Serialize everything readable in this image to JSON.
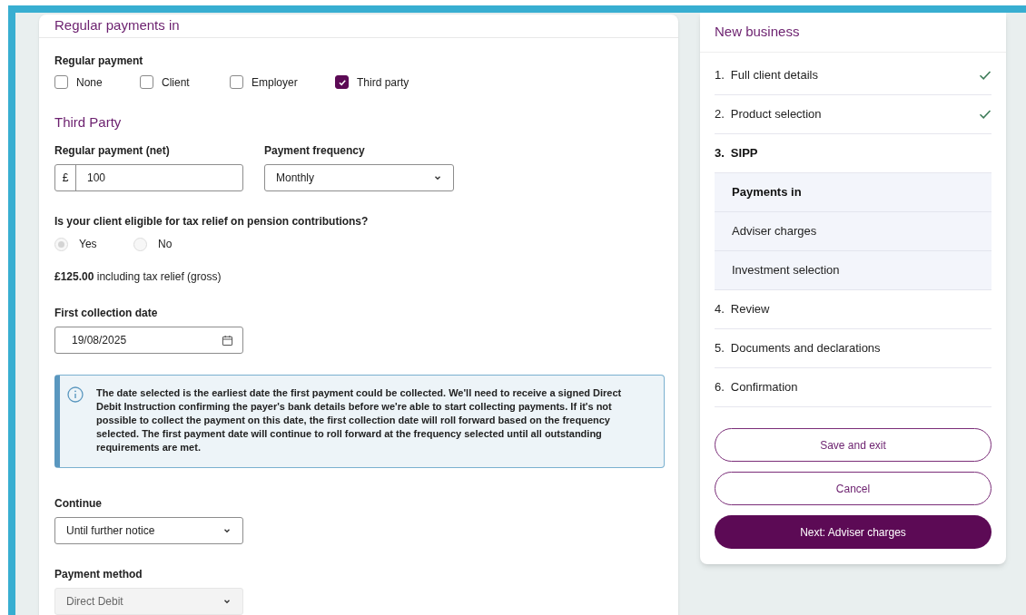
{
  "form": {
    "title": "Regular payments in",
    "regular_payment": {
      "label": "Regular payment",
      "options": [
        {
          "label": "None",
          "checked": false
        },
        {
          "label": "Client",
          "checked": false
        },
        {
          "label": "Employer",
          "checked": false
        },
        {
          "label": "Third party",
          "checked": true
        }
      ]
    },
    "section_title": "Third Party",
    "amount": {
      "label": "Regular payment (net)",
      "prefix": "£",
      "value": "100"
    },
    "frequency": {
      "label": "Payment frequency",
      "value": "Monthly"
    },
    "tax_relief": {
      "question": "Is your client eligible for tax relief on pension contributions?",
      "disabled": true,
      "options": [
        {
          "label": "Yes",
          "selected": true
        },
        {
          "label": "No",
          "selected": false
        }
      ]
    },
    "gross": "**£125.00** including tax relief (gross)",
    "collection_date": {
      "label": "First collection date",
      "value": "19/08/2025"
    },
    "info": "The date selected is the earliest date the first payment could be collected. We'll need to receive a signed Direct Debit Instruction confirming the payer's bank details before we're able to start collecting payments. If it's not possible to collect the payment on this date, the first collection date will roll forward based on the frequency selected. The first payment date will continue to roll forward at the frequency selected until all outstanding requirements are met.",
    "continue": {
      "label": "Continue",
      "value": "Until further notice"
    },
    "payment_method": {
      "label": "Payment method",
      "value": "Direct Debit",
      "disabled": true
    }
  },
  "sidebar": {
    "title": "New business",
    "steps": [
      {
        "number": "1.",
        "label": "Full client details",
        "done": true,
        "current": false
      },
      {
        "number": "2.",
        "label": "Product selection",
        "done": true,
        "current": false
      },
      {
        "number": "3.",
        "label": "SIPP",
        "done": false,
        "current": true,
        "children": [
          {
            "label": "Payments in",
            "selected": true
          },
          {
            "label": "Adviser charges",
            "selected": false
          },
          {
            "label": "Investment selection",
            "selected": false
          }
        ]
      },
      {
        "number": "4.",
        "label": "Review",
        "done": false,
        "current": false
      },
      {
        "number": "5.",
        "label": "Documents and declarations",
        "done": false,
        "current": false
      },
      {
        "number": "6.",
        "label": "Confirmation",
        "done": false,
        "current": false
      }
    ],
    "buttons": [
      {
        "label": "Save and exit",
        "kind": "outline"
      },
      {
        "label": "Cancel",
        "kind": "outline"
      },
      {
        "label": "Next: Adviser charges",
        "kind": "primary"
      }
    ]
  }
}
